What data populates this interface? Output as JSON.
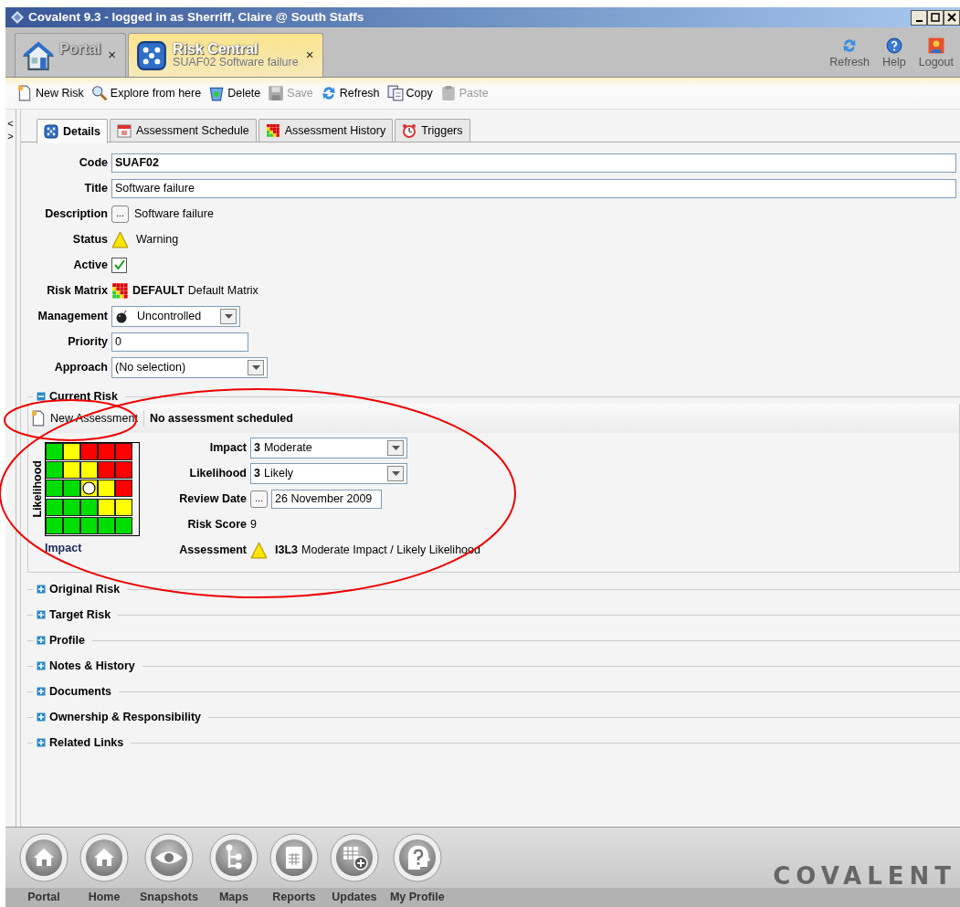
{
  "window": {
    "title": "Covalent 9.3 - logged in as Sherriff, Claire @ South Staffs"
  },
  "app_tabs": [
    {
      "kind": "house",
      "title": "Portal",
      "selected": false,
      "close": "×"
    },
    {
      "kind": "dice",
      "title": "Risk Central",
      "subtitle": "SUAF02 Software failure",
      "selected": true,
      "close": "×"
    }
  ],
  "header_actions": [
    {
      "kind": "refresh",
      "label": "Refresh"
    },
    {
      "kind": "help",
      "label": "Help"
    },
    {
      "kind": "user",
      "label": "Logout"
    }
  ],
  "toolbar": [
    {
      "kind": "new",
      "label": "New Risk",
      "disabled": false
    },
    {
      "kind": "search",
      "label": "Explore from here",
      "disabled": false
    },
    {
      "kind": "recycle",
      "label": "Delete",
      "disabled": false
    },
    {
      "kind": "disk",
      "label": "Save",
      "disabled": true
    },
    {
      "kind": "refresh",
      "label": "Refresh",
      "disabled": false
    },
    {
      "kind": "copy",
      "label": "Copy",
      "disabled": false
    },
    {
      "kind": "paste",
      "label": "Paste",
      "disabled": true
    }
  ],
  "side_arrows": [
    "<",
    ">"
  ],
  "tabs": [
    {
      "kind": "dice",
      "label": "Details",
      "selected": true
    },
    {
      "kind": "calendar",
      "label": "Assessment Schedule",
      "selected": false
    },
    {
      "kind": "matrix",
      "label": "Assessment History",
      "selected": false
    },
    {
      "kind": "clock",
      "label": "Triggers",
      "selected": false
    }
  ],
  "fields": [
    {
      "kind": "text",
      "label": "Code",
      "value": "SUAF02",
      "bold": true
    },
    {
      "kind": "text",
      "label": "Title",
      "value": "Software failure",
      "bold": false
    },
    {
      "kind": "memo",
      "label": "Description",
      "button": "...",
      "value": "Software failure"
    },
    {
      "kind": "status",
      "label": "Status",
      "value": "Warning"
    },
    {
      "kind": "checkbox",
      "label": "Active",
      "checked": true
    },
    {
      "kind": "matrix",
      "label": "Risk Matrix",
      "code": "DEFAULT",
      "value": "Default Matrix"
    },
    {
      "kind": "icon-select",
      "label": "Management",
      "value": "Uncontrolled"
    },
    {
      "kind": "number",
      "label": "Priority",
      "value": "0"
    },
    {
      "kind": "select",
      "label": "Approach",
      "value": "(No selection)"
    }
  ],
  "current_risk": {
    "title": "Current Risk",
    "expanded": true,
    "new_assessment": "New Assessment",
    "schedule_note": "No assessment scheduled",
    "matrix": {
      "ylabel": "Likelihood",
      "xlabel": "Impact",
      "rows": [
        [
          {
            "color": "#00dd00",
            "selected": false
          },
          {
            "color": "#ffff00",
            "selected": false
          },
          {
            "color": "#ff0000",
            "selected": false
          },
          {
            "color": "#ff0000",
            "selected": false
          },
          {
            "color": "#ff0000",
            "selected": false
          }
        ],
        [
          {
            "color": "#00dd00",
            "selected": false
          },
          {
            "color": "#ffff00",
            "selected": false
          },
          {
            "color": "#ffff00",
            "selected": false
          },
          {
            "color": "#ff0000",
            "selected": false
          },
          {
            "color": "#ff0000",
            "selected": false
          }
        ],
        [
          {
            "color": "#00dd00",
            "selected": false
          },
          {
            "color": "#00dd00",
            "selected": false
          },
          {
            "color": "#ffff00",
            "selected": true
          },
          {
            "color": "#ffff00",
            "selected": false
          },
          {
            "color": "#ff0000",
            "selected": false
          }
        ],
        [
          {
            "color": "#00dd00",
            "selected": false
          },
          {
            "color": "#00dd00",
            "selected": false
          },
          {
            "color": "#00dd00",
            "selected": false
          },
          {
            "color": "#ffff00",
            "selected": false
          },
          {
            "color": "#ffff00",
            "selected": false
          }
        ],
        [
          {
            "color": "#00dd00",
            "selected": false
          },
          {
            "color": "#00dd00",
            "selected": false
          },
          {
            "color": "#00dd00",
            "selected": false
          },
          {
            "color": "#00dd00",
            "selected": false
          },
          {
            "color": "#00dd00",
            "selected": false
          }
        ]
      ]
    },
    "fields": [
      {
        "kind": "select",
        "label": "Impact",
        "number": "3",
        "value": "Moderate"
      },
      {
        "kind": "select",
        "label": "Likelihood",
        "number": "3",
        "value": "Likely"
      },
      {
        "kind": "date",
        "label": "Review Date",
        "button": "...",
        "value": "26 November 2009"
      },
      {
        "kind": "plain",
        "label": "Risk Score",
        "value": "9"
      },
      {
        "kind": "assessment",
        "label": "Assessment",
        "code": "I3L3",
        "value": "Moderate Impact / Likely Likelihood"
      }
    ]
  },
  "sections": [
    {
      "title": "Original Risk",
      "expanded": false
    },
    {
      "title": "Target Risk",
      "expanded": false
    },
    {
      "title": "Profile",
      "expanded": false
    },
    {
      "title": "Notes & History",
      "expanded": false
    },
    {
      "title": "Documents",
      "expanded": false
    },
    {
      "title": "Ownership & Responsibility",
      "expanded": false
    },
    {
      "title": "Related Links",
      "expanded": false
    }
  ],
  "dock": [
    {
      "kind": "house",
      "label": "Portal"
    },
    {
      "kind": "house",
      "label": "Home"
    },
    {
      "kind": "eye",
      "label": "Snapshots"
    },
    {
      "kind": "tree",
      "label": "Maps"
    },
    {
      "kind": "report",
      "label": "Reports"
    },
    {
      "kind": "grid-plus",
      "label": "Updates"
    },
    {
      "kind": "question",
      "label": "My Profile"
    }
  ],
  "logo": "COVALENT",
  "annotation_marks": [
    {
      "kind": "ellipse"
    },
    {
      "kind": "ellipse"
    }
  ]
}
